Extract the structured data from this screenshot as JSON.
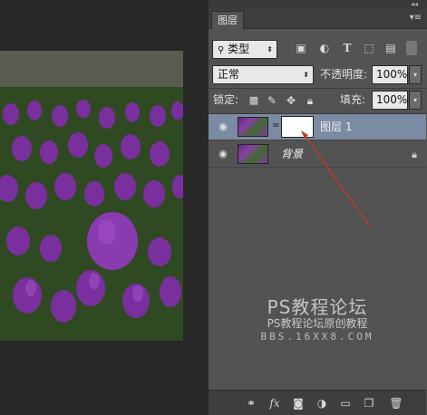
{
  "panel": {
    "tab_label": "图层",
    "filter": {
      "label": "类型"
    },
    "blend_mode": "正常",
    "opacity_label": "不透明度:",
    "opacity_value": "100%",
    "lock_label": "锁定:",
    "fill_label": "填充:",
    "fill_value": "100%"
  },
  "layers": [
    {
      "name": "图层 1",
      "selected": true,
      "has_mask": true,
      "locked": false
    },
    {
      "name": "背景",
      "selected": false,
      "has_mask": false,
      "locked": true
    }
  ],
  "watermark": {
    "line1": "PS教程论坛",
    "line2": "PS教程论坛原创教程",
    "line3": "BBS.16XX8.COM"
  },
  "icons": {
    "filter_tools": [
      "image-filter-icon",
      "adjustment-filter-icon",
      "text-filter-icon",
      "shape-filter-icon",
      "smart-object-filter-icon"
    ],
    "lock_tools": [
      "lock-pixels-icon",
      "lock-paint-icon",
      "lock-position-icon",
      "lock-all-icon"
    ],
    "bottom_tools": [
      "link-layers-icon",
      "fx-icon",
      "add-mask-icon",
      "adjustment-layer-icon",
      "new-group-icon",
      "new-layer-icon",
      "trash-icon"
    ]
  },
  "colors": {
    "panel_bg": "#535353",
    "selected_layer": "#7a8ba3",
    "annotation_arrow": "#c0392b"
  }
}
